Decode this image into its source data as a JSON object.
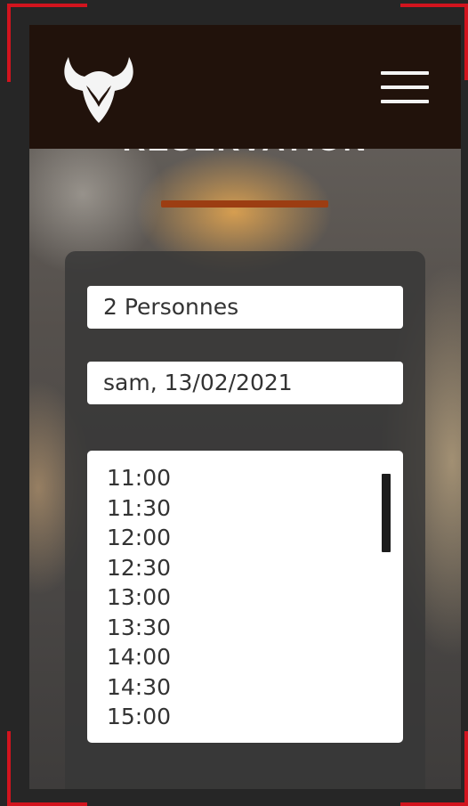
{
  "header": {
    "logo_icon": "bull-head-icon",
    "menu_icon": "hamburger-menu-icon"
  },
  "page": {
    "title": "RÉSERVATION",
    "accent_color": "#9c3d12",
    "frame_color": "#d2141e"
  },
  "form": {
    "persons_value": "2 Personnes",
    "date_value": "sam, 13/02/2021",
    "times": [
      "11:00",
      "11:30",
      "12:00",
      "12:30",
      "13:00",
      "13:30",
      "14:00",
      "14:30",
      "15:00"
    ]
  }
}
